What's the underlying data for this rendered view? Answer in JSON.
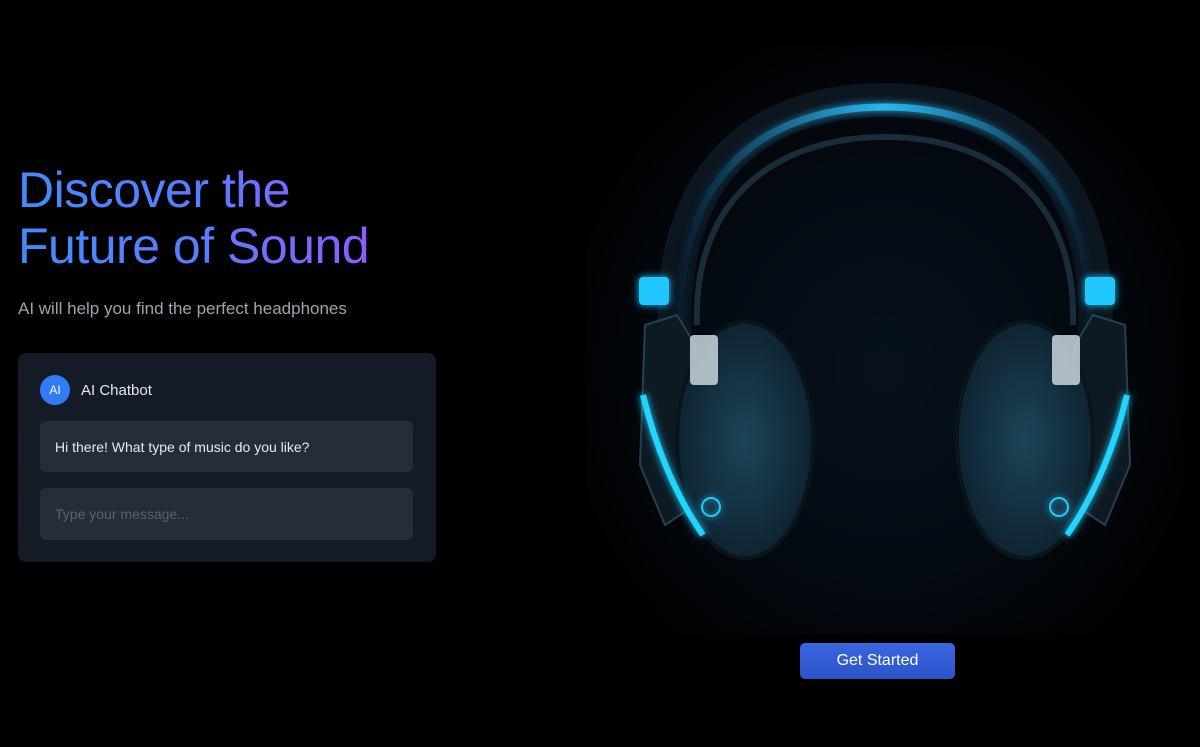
{
  "hero": {
    "title_line1": "Discover the",
    "title_line2": "Future of Sound",
    "subtitle": "AI will help you find the perfect headphones"
  },
  "chat": {
    "avatar_initials": "AI",
    "bot_name": "AI Chatbot",
    "message": "Hi there! What type of music do you like?",
    "input_value": "",
    "input_placeholder": "Type your message..."
  },
  "image": {
    "subject": "headphones-illustration",
    "accent_color": "#21c8ff"
  },
  "cta": {
    "label": "Get Started"
  },
  "colors": {
    "background": "#000000",
    "title_gradient_start": "#3f8cff",
    "title_gradient_end": "#8f5cff",
    "card_background": "#141a26",
    "bubble_background": "#252c3a",
    "button": "#2f5bd6"
  }
}
